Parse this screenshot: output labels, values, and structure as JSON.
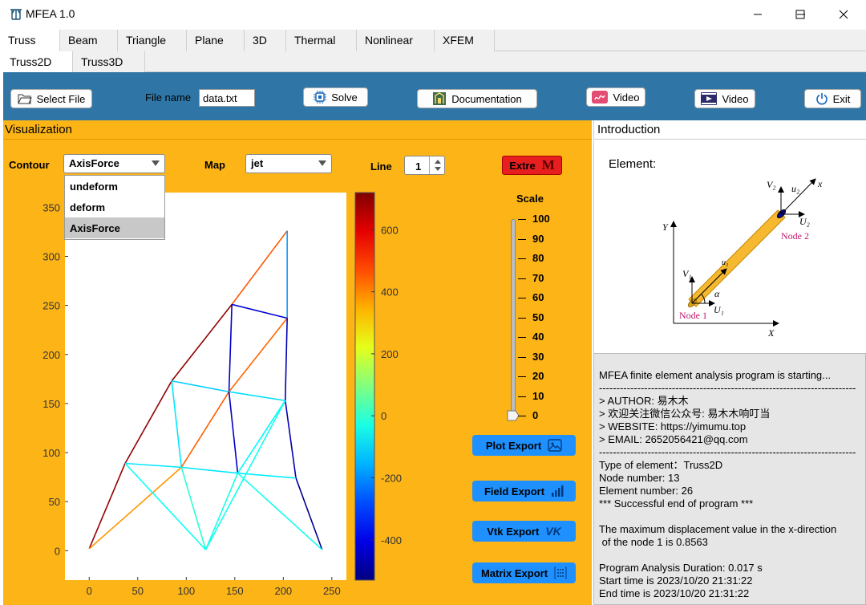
{
  "window": {
    "title": "MFEA 1.0",
    "minimize_icon": "minimize-icon",
    "maximize_icon": "maximize-icon",
    "close_icon": "close-icon"
  },
  "tabs": {
    "main": [
      "Truss",
      "Beam",
      "Triangle",
      "Plane",
      "3D",
      "Thermal",
      "Nonlinear",
      "XFEM"
    ],
    "sub": [
      "Truss2D",
      "Truss3D"
    ]
  },
  "toolbar": {
    "select_file": "Select File",
    "file_name_label": "File name",
    "file_name_value": "data.txt",
    "solve": "Solve",
    "documentation": "Documentation",
    "video1": "Video",
    "video2": "Video",
    "exit": "Exit"
  },
  "visualization": {
    "title": "Visualization",
    "contour_label": "Contour",
    "contour_value": "AxisForce",
    "contour_options": [
      "undeform",
      "deform",
      "AxisForce"
    ],
    "map_label": "Map",
    "map_value": "jet",
    "line_label": "Line",
    "line_value": "1",
    "extre": "Extre",
    "extre_icon": "M",
    "scale_label": "Scale",
    "scale_ticks": [
      "100",
      "90",
      "80",
      "70",
      "60",
      "50",
      "40",
      "30",
      "20",
      "10",
      "0"
    ],
    "scale_value": 0,
    "buttons": {
      "plot": "Plot Export",
      "field": "Field Export",
      "vtk": "Vtk Export",
      "vtk_icon": "VK",
      "matrix": "Matrix Export"
    }
  },
  "introduction": {
    "title": "Introduction",
    "element_label": "Element:",
    "diagram": {
      "v2": "V₂",
      "u2": "u₂",
      "x": "x",
      "U2": "U₂",
      "node2": "Node 2",
      "Y": "Y",
      "u1": "u₁",
      "V1": "V₁",
      "alpha": "α",
      "node1": "Node 1",
      "U1": "U₁",
      "X": "X"
    }
  },
  "log": [
    "MFEA finite element analysis program is starting...",
    "--------------------------------------------------------------------------",
    "> AUTHOR: 易木木",
    "> 欢迎关注微信公众号: 易木木响叮当",
    "> WEBSITE: https://yimumu.top",
    "> EMAIL: 2652056421@qq.com",
    "--------------------------------------------------------------------------",
    "Type of element：Truss2D",
    "Node number: 13",
    "Element number: 26",
    "*** Successful end of program ***",
    "",
    "The maximum displacement value in the x-direction",
    " of the node 1 is 0.8563",
    "",
    "Program Analysis Duration: 0.017 s",
    "Start time is 2023/10/20 21:31:22",
    "End time is 2023/10/20 21:31:22"
  ],
  "chart_data": {
    "type": "line",
    "xlim": [
      -25,
      265
    ],
    "ylim": [
      -30,
      365
    ],
    "x_ticks": [
      0,
      50,
      100,
      150,
      200,
      250
    ],
    "y_ticks": [
      0,
      50,
      100,
      150,
      200,
      250,
      300,
      350
    ],
    "colorbar": {
      "min": -530,
      "max": 720,
      "ticks": [
        600,
        400,
        200,
        0,
        -200,
        -400
      ]
    },
    "colormap": "jet",
    "elements": [
      {
        "x": [
          0,
          37
        ],
        "y": [
          2,
          89
        ],
        "v": 690
      },
      {
        "x": [
          37,
          85
        ],
        "y": [
          89,
          173
        ],
        "v": 700
      },
      {
        "x": [
          85,
          147
        ],
        "y": [
          173,
          251
        ],
        "v": 700
      },
      {
        "x": [
          147,
          204
        ],
        "y": [
          251,
          326
        ],
        "v": 460
      },
      {
        "x": [
          204,
          204
        ],
        "y": [
          326,
          237
        ],
        "v": -180
      },
      {
        "x": [
          147,
          204
        ],
        "y": [
          251,
          237
        ],
        "v": -430
      },
      {
        "x": [
          147,
          144
        ],
        "y": [
          251,
          162
        ],
        "v": -440
      },
      {
        "x": [
          144,
          204
        ],
        "y": [
          162,
          237
        ],
        "v": 440
      },
      {
        "x": [
          204,
          202
        ],
        "y": [
          237,
          153
        ],
        "v": -470
      },
      {
        "x": [
          85,
          144
        ],
        "y": [
          173,
          162
        ],
        "v": -120
      },
      {
        "x": [
          144,
          202
        ],
        "y": [
          162,
          153
        ],
        "v": -100
      },
      {
        "x": [
          85,
          95
        ],
        "y": [
          173,
          85
        ],
        "v": -90
      },
      {
        "x": [
          95,
          144
        ],
        "y": [
          85,
          162
        ],
        "v": 450
      },
      {
        "x": [
          144,
          153
        ],
        "y": [
          162,
          79
        ],
        "v": -450
      },
      {
        "x": [
          153,
          202
        ],
        "y": [
          79,
          153
        ],
        "v": -70
      },
      {
        "x": [
          202,
          213
        ],
        "y": [
          153,
          74
        ],
        "v": -470
      },
      {
        "x": [
          213,
          240
        ],
        "y": [
          74,
          1
        ],
        "v": -510
      },
      {
        "x": [
          0,
          95
        ],
        "y": [
          2,
          85
        ],
        "v": 380
      },
      {
        "x": [
          37,
          95
        ],
        "y": [
          89,
          85
        ],
        "v": -90
      },
      {
        "x": [
          95,
          153
        ],
        "y": [
          85,
          79
        ],
        "v": -90
      },
      {
        "x": [
          153,
          213
        ],
        "y": [
          79,
          74
        ],
        "v": -80
      },
      {
        "x": [
          95,
          120
        ],
        "y": [
          85,
          1
        ],
        "v": -10
      },
      {
        "x": [
          37,
          120
        ],
        "y": [
          89,
          1
        ],
        "v": -50
      },
      {
        "x": [
          120,
          153
        ],
        "y": [
          1,
          79
        ],
        "v": -30
      },
      {
        "x": [
          120,
          202
        ],
        "y": [
          1,
          153
        ],
        "v": -40
      },
      {
        "x": [
          153,
          240
        ],
        "y": [
          79,
          1
        ],
        "v": -40
      }
    ]
  },
  "colors": {
    "toolbar": "#2f76a6",
    "panel": "#fcb417",
    "button_blue": "#1e90ff",
    "extre": "#e81f1f"
  }
}
